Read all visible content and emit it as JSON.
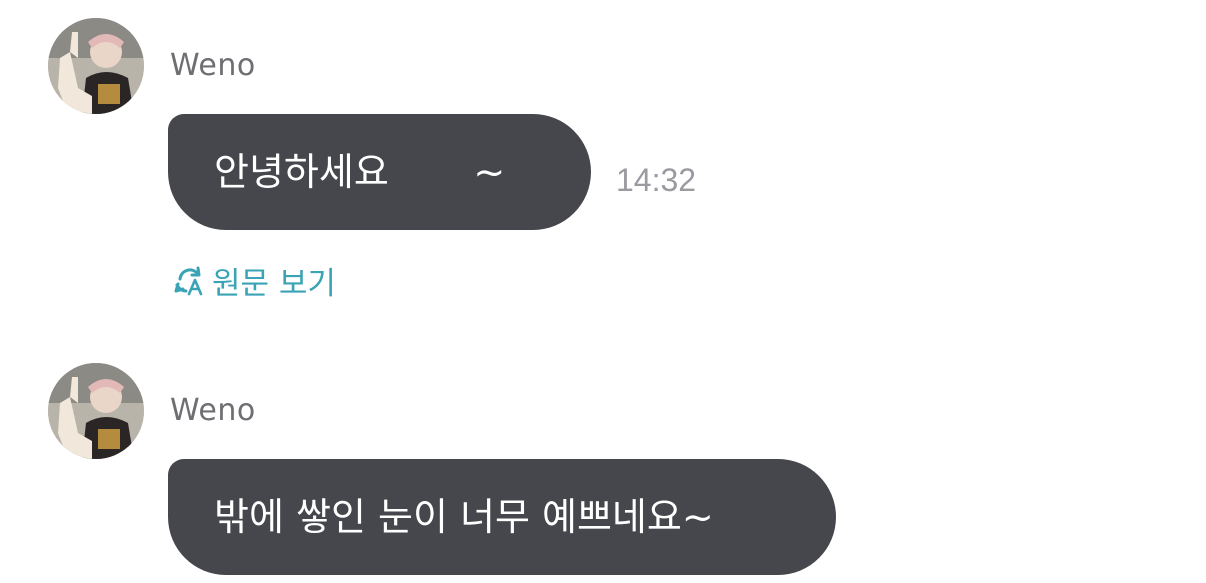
{
  "messages": [
    {
      "sender": "Weno",
      "text": "안녕하세요       ~",
      "time": "14:32",
      "translate_label": "원문 보기"
    },
    {
      "sender": "Weno",
      "text": "밖에 쌓인 눈이 너무 예쁘네요~"
    }
  ],
  "colors": {
    "bubble": "#45474d",
    "bubble_text": "#ffffff",
    "sender": "#6e6e73",
    "time": "#9a9aa0",
    "translate": "#3aa3b5"
  },
  "icons": {
    "translate": "translate-refresh-icon",
    "avatar": "avatar"
  }
}
